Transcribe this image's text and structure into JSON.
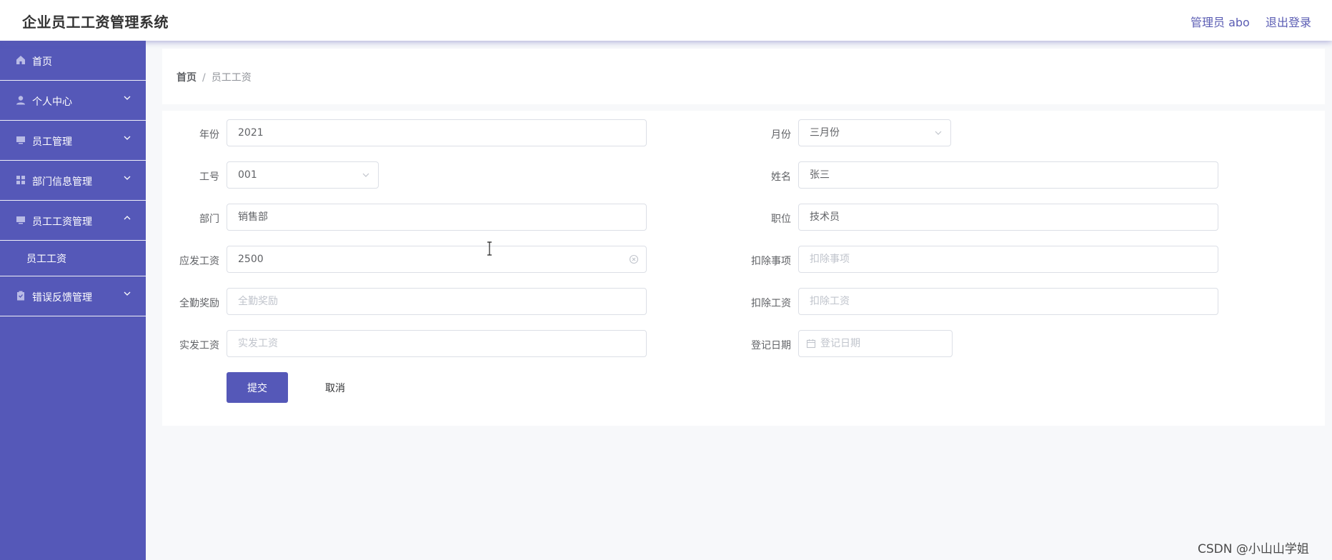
{
  "header": {
    "title": "企业员工工资管理系统",
    "user": "管理员 abo",
    "logout": "退出登录"
  },
  "sidebar": {
    "items": [
      {
        "label": "首页",
        "icon": "home-icon"
      },
      {
        "label": "个人中心",
        "icon": "user-icon",
        "expanded": false
      },
      {
        "label": "员工管理",
        "icon": "monitor-icon",
        "expanded": false
      },
      {
        "label": "部门信息管理",
        "icon": "grid-icon",
        "expanded": false
      },
      {
        "label": "员工工资管理",
        "icon": "monitor-icon",
        "expanded": true
      },
      {
        "label": "错误反馈管理",
        "icon": "clipboard-icon",
        "expanded": false
      }
    ],
    "subitem": "员工工资"
  },
  "breadcrumb": {
    "home": "首页",
    "separator": "/",
    "current": "员工工资"
  },
  "form": {
    "year": {
      "label": "年份",
      "value": "2021"
    },
    "month": {
      "label": "月份",
      "value": "三月份"
    },
    "emp_no": {
      "label": "工号",
      "value": "001"
    },
    "name": {
      "label": "姓名",
      "value": "张三"
    },
    "dept": {
      "label": "部门",
      "value": "销售部"
    },
    "position": {
      "label": "职位",
      "value": "技术员"
    },
    "gross": {
      "label": "应发工资",
      "value": "2500"
    },
    "deduct_item": {
      "label": "扣除事项",
      "placeholder": "扣除事项"
    },
    "attendance_bonus": {
      "label": "全勤奖励",
      "placeholder": "全勤奖励"
    },
    "deduct_pay": {
      "label": "扣除工资",
      "placeholder": "扣除工资"
    },
    "net_pay": {
      "label": "实发工资",
      "placeholder": "实发工资"
    },
    "reg_date": {
      "label": "登记日期",
      "placeholder": "登记日期"
    },
    "submit": "提交",
    "cancel": "取消"
  },
  "watermark": "CSDN @小山山学姐",
  "colors": {
    "accent": "#5558b8",
    "header_text": "#5a5cb3"
  }
}
